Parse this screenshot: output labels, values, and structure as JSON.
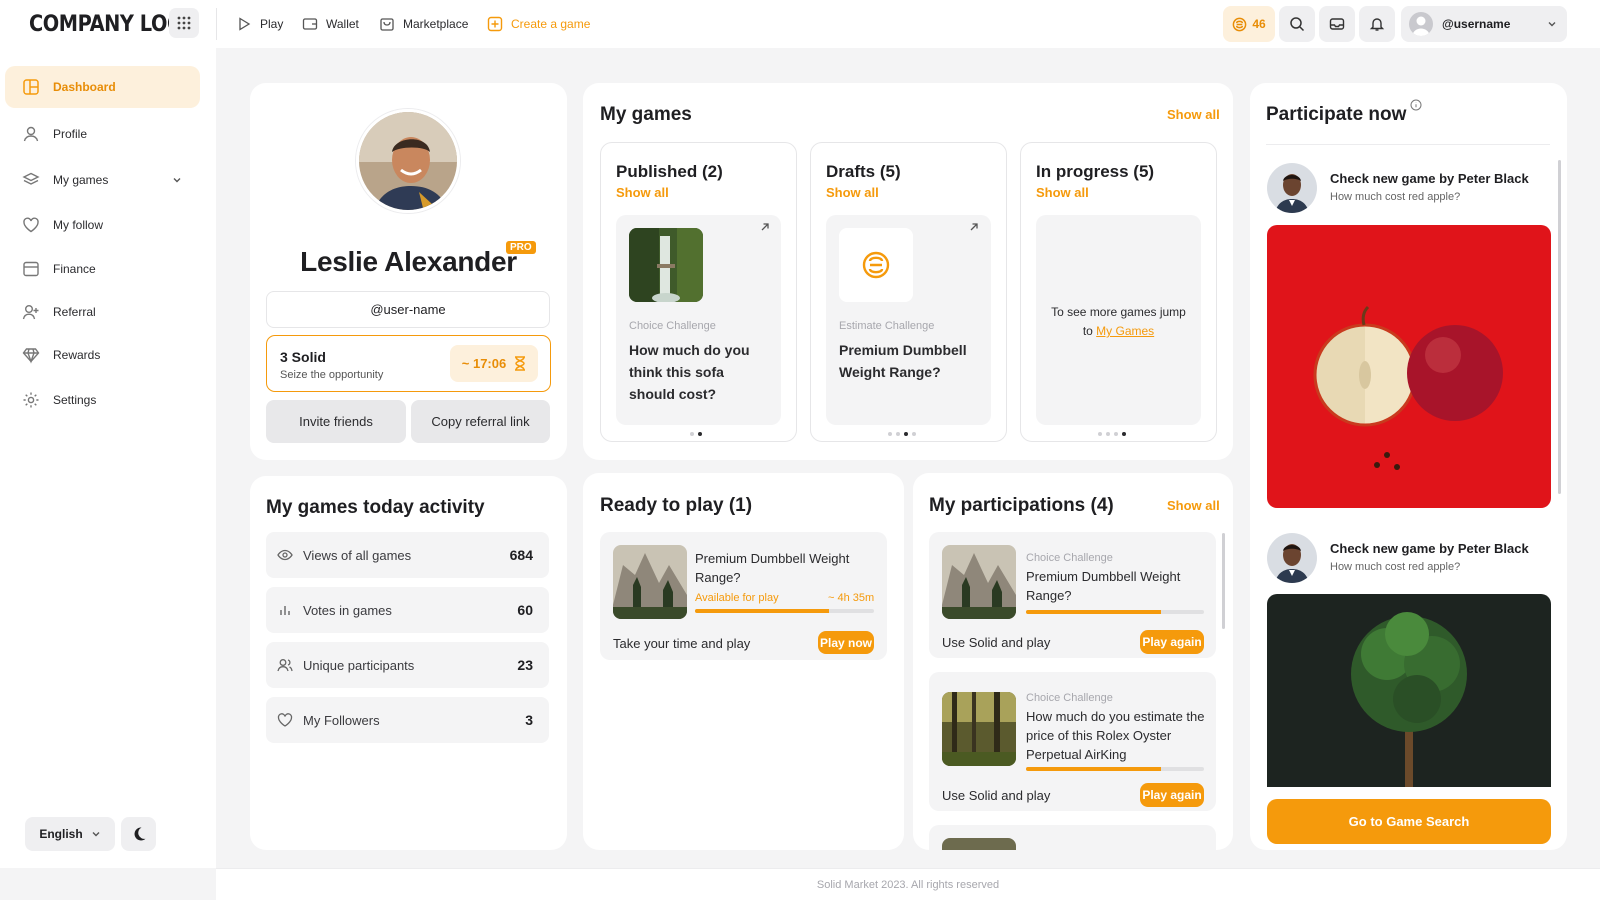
{
  "header": {
    "logo": "COMPANY LOGO",
    "nav": [
      "Play",
      "Wallet",
      "Marketplace",
      "Create a game"
    ],
    "coins": "46",
    "username": "@username"
  },
  "sidebar": {
    "items": [
      "Dashboard",
      "Profile",
      "My games",
      "My follow",
      "Finance",
      "Referral",
      "Rewards",
      "Settings"
    ],
    "language": "English"
  },
  "profile": {
    "name": "Leslie Alexander",
    "badge": "PRO",
    "handle": "@user-name",
    "solid_title": "3 Solid",
    "solid_sub": "Seize the opportunity",
    "timer": "~ 17:06",
    "invite": "Invite friends",
    "copy_link": "Copy referral link"
  },
  "my_games": {
    "title": "My games",
    "show_all": "Show all",
    "published": {
      "title": "Published (2)",
      "show_all": "Show all",
      "category": "Choice Challenge",
      "question": "How much do you think this sofa should cost?"
    },
    "drafts": {
      "title": "Drafts (5)",
      "show_all": "Show all",
      "category": "Estimate Challenge",
      "question": "Premium Dumbbell Weight Range?"
    },
    "in_progress": {
      "title": "In progress (5)",
      "show_all": "Show all",
      "text": "To see more games jump to",
      "link": "My Games"
    }
  },
  "activity": {
    "title": "My games today activity",
    "rows": [
      {
        "label": "Views of all games",
        "value": "684"
      },
      {
        "label": "Votes in games",
        "value": "60"
      },
      {
        "label": "Unique participants",
        "value": "23"
      },
      {
        "label": "My Followers",
        "value": "3"
      }
    ]
  },
  "ready": {
    "title": "Ready to play (1)",
    "game_title": "Premium Dumbbell Weight Range?",
    "status": "Available for play",
    "time": "~ 4h 35m",
    "progress": 0.75,
    "footer": "Take your time and play",
    "button": "Play now"
  },
  "participations": {
    "title": "My participations (4)",
    "show_all": "Show all",
    "items": [
      {
        "category": "Choice Challenge",
        "title": "Premium Dumbbell Weight Range?",
        "progress": 0.76,
        "footer": "Use Solid and play",
        "button": "Play again"
      },
      {
        "category": "Choice Challenge",
        "title": "How much do you estimate the price of this Rolex Oyster Perpetual AirKing",
        "progress": 0.76,
        "footer": "Use Solid and play",
        "button": "Play again"
      }
    ]
  },
  "participate": {
    "title": "Participate now",
    "posts": [
      {
        "title": "Check new game by Peter Black",
        "sub": "How much cost red apple?"
      },
      {
        "title": "Check new game by Peter Black",
        "sub": "How much cost red apple?"
      }
    ],
    "button": "Go to Game Search"
  },
  "footer": "Solid Market 2023. All rights reserved"
}
